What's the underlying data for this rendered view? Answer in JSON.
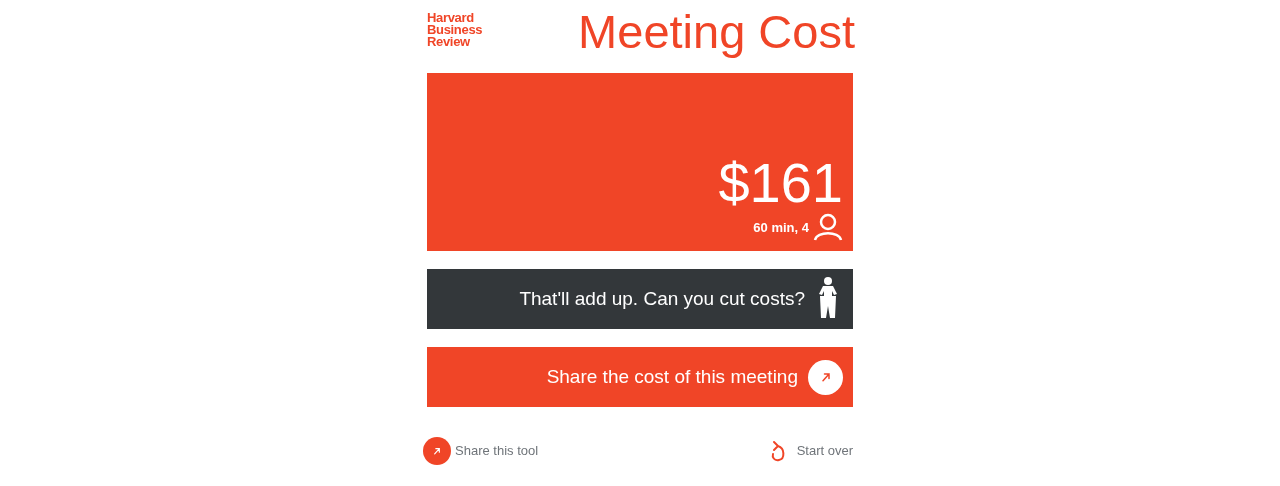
{
  "logo": [
    "Harvard",
    "Business",
    "Review"
  ],
  "title": "Meeting Cost",
  "cost": {
    "amount": "$161",
    "detail": "60 min, 4"
  },
  "tip": {
    "text": "That'll add up. Can you cut costs?"
  },
  "share_meeting": {
    "label": "Share the cost of this meeting"
  },
  "footer": {
    "share": "Share this tool",
    "restart": "Start over"
  }
}
